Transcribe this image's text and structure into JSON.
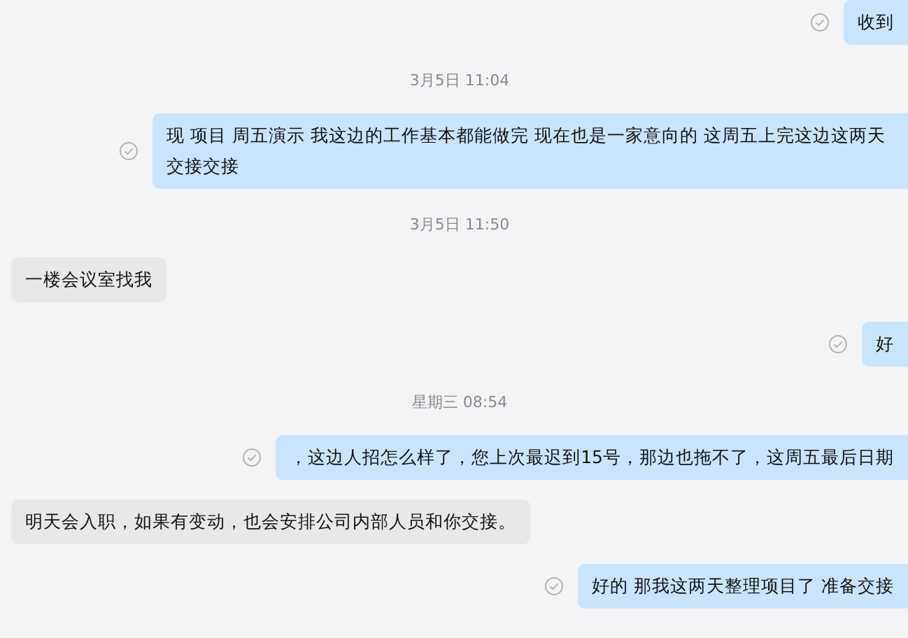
{
  "messages": [
    {
      "kind": "sent",
      "text": "收到"
    },
    {
      "kind": "time",
      "text": "3月5日 11:04"
    },
    {
      "kind": "sent",
      "text": "现 项目 周五演示 我这边的工作基本都能做完 现在也是一家意向的 这周五上完这边这两天交接交接"
    },
    {
      "kind": "time",
      "text": "3月5日 11:50"
    },
    {
      "kind": "received",
      "text": "一楼会议室找我"
    },
    {
      "kind": "sent",
      "text": "好"
    },
    {
      "kind": "time",
      "text": "星期三 08:54"
    },
    {
      "kind": "sent",
      "text": "，这边人招怎么样了，您上次最迟到15号，那边也拖不了，这周五最后日期"
    },
    {
      "kind": "received",
      "text": "明天会入职，如果有变动，也会安排公司内部人员和你交接。"
    },
    {
      "kind": "sent",
      "text": "好的 那我这两天整理项目了 准备交接"
    }
  ]
}
